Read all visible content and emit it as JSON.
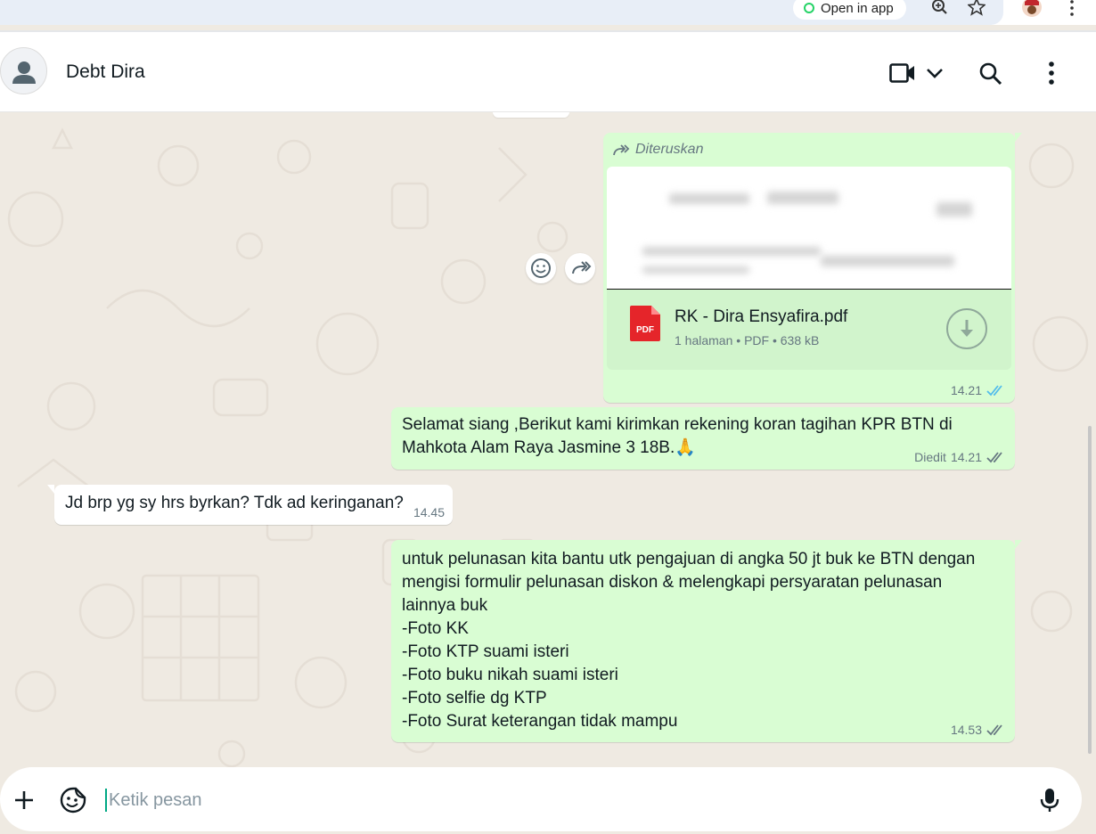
{
  "browser": {
    "open_in_app_label": "Open in app",
    "icons": [
      "whatsapp-icon",
      "zoom-in-icon",
      "star-icon",
      "profile-avatar-icon",
      "kebab-menu-icon"
    ]
  },
  "header": {
    "contact_name": "Debt Dira",
    "icons": [
      "avatar-icon",
      "video-call-icon",
      "chevron-down-icon",
      "search-icon",
      "more-options-icon"
    ]
  },
  "messages": [
    {
      "direction": "outgoing",
      "forwarded_label": "Diteruskan",
      "document": {
        "name": "RK - Dira Ensyafira.pdf",
        "pages": "1 halaman",
        "type": "PDF",
        "size": "638 kB",
        "separator": "•",
        "icon_label": "PDF"
      },
      "time": "14.21",
      "status": "read"
    },
    {
      "direction": "outgoing",
      "text": "Selamat siang ,Berikut kami kirimkan rekening koran tagihan KPR BTN di\nMahkota Alam Raya Jasmine 3 18B.🙏",
      "edited_label": "Diedit",
      "time": "14.21",
      "status": "delivered"
    },
    {
      "direction": "incoming",
      "text": "Jd brp yg sy hrs byrkan? Tdk ad keringanan?",
      "time": "14.45"
    },
    {
      "direction": "outgoing",
      "text": "untuk pelunasan kita bantu utk pengajuan di angka 50 jt buk ke BTN dengan\nmengisi formulir pelunasan diskon & melengkapi persyaratan pelunasan\nlainnya buk\n-Foto KK\n-Foto KTP suami isteri\n-Foto buku nikah suami isteri\n-Foto selfie dg KTP\n-Foto Surat keterangan tidak mampu",
      "time": "14.53",
      "status": "delivered"
    }
  ],
  "composer": {
    "placeholder": "Ketik pesan",
    "icons": [
      "plus-icon",
      "sticker-icon",
      "microphone-icon"
    ]
  },
  "colors": {
    "outgoing_bubble": "#d9fdd3",
    "incoming_bubble": "#ffffff",
    "chat_background": "#efeae2",
    "read_ticks": "#53bdeb",
    "pdf_red": "#e5252a"
  }
}
